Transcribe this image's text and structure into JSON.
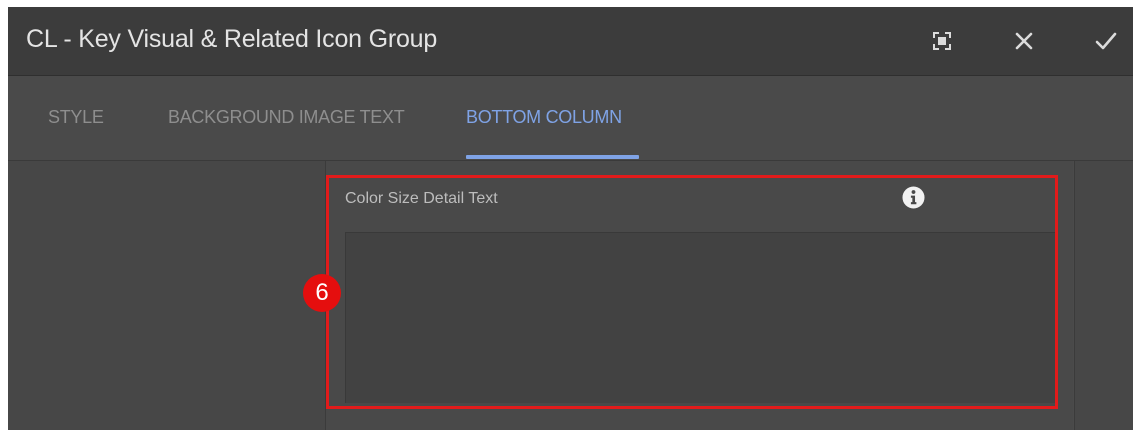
{
  "dialog": {
    "title": "CL - Key Visual & Related Icon Group",
    "icons": {
      "fullscreen": "fullscreen-icon",
      "close": "close-icon",
      "confirm": "check-icon"
    }
  },
  "tabs": [
    {
      "label": "STYLE",
      "active": false
    },
    {
      "label": "BACKGROUND IMAGE TEXT",
      "active": false
    },
    {
      "label": "BOTTOM COLUMN",
      "active": true
    }
  ],
  "field": {
    "label": "Color Size Detail Text",
    "value": "",
    "info_icon": "info-icon"
  },
  "annotation": {
    "marker": "6",
    "color": "#e50e0e"
  },
  "colors": {
    "accent": "#7fa3e6",
    "titlebar": "#3c3c3c",
    "panel": "#4a4a4a"
  }
}
